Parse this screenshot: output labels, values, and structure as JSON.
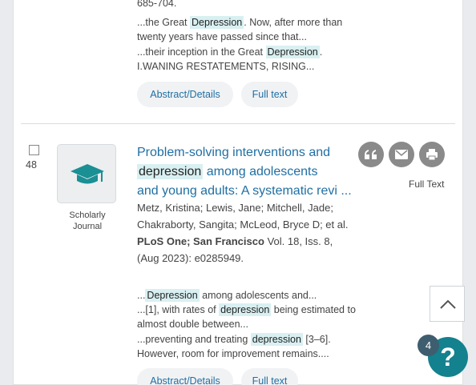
{
  "prev": {
    "pages": "685-704.",
    "snippet1_pre": "...the Great ",
    "snippet1_hl": "Depression",
    "snippet1_post": ". Now, after more than twenty years have passed since that...",
    "snippet2_pre": "...their inception in the Great ",
    "snippet2_hl": "Depression",
    "snippet2_post": ". I.WANING RESTATEMENTS, RISING...",
    "abstract_label": "Abstract/Details",
    "fulltext_label": "Full text"
  },
  "result": {
    "number": "48",
    "type_label": "Scholarly Journal",
    "title_pre": "Problem-solving interventions and",
    "title_hl": "depression",
    "title_mid": "among adolescents",
    "title_post": "and young adults: A systematic revi ...",
    "authors": "Metz, Kristina; Lewis, Jane; Mitchell, Jade; Chakraborty, Sangita; McLeod, Bryce D; et al.",
    "source": "PLoS One; San Francisco",
    "volume": "Vol. 18, Iss. 8,",
    "date": "(Aug 2023):",
    "doi": "e0285949.",
    "snip1_pre": "...",
    "snip1_hl": "Depression",
    "snip1_post": " among adolescents and...",
    "snip2_pre": "...[1], with rates of ",
    "snip2_hl": "depression",
    "snip2_post": " being estimated to almost double between...",
    "snip3_pre": "...preventing and treating ",
    "snip3_hl": "depression",
    "snip3_post": " [3–6]. However, room for improvement remains....",
    "abstract_label": "Abstract/Details",
    "fulltext_label": "Full text",
    "fulltext_icon_label": "Full Text"
  },
  "widgets": {
    "notification_count": "4",
    "help_glyph": "?"
  },
  "icons": {
    "cite": "quote-icon",
    "email": "email-icon",
    "print": "print-icon",
    "scroll_top": "chevron-up-icon",
    "type": "mortarboard-icon"
  }
}
